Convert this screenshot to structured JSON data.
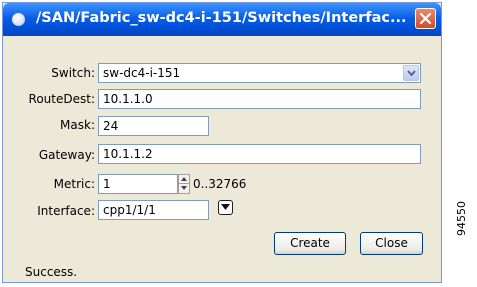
{
  "window": {
    "title": "/SAN/Fabric_sw-dc4-i-151/Switches/Interfac..."
  },
  "form": {
    "switch": {
      "label": "Switch:",
      "value": "sw-dc4-i-151"
    },
    "route_dest": {
      "label": "RouteDest:",
      "value": "10.1.1.0"
    },
    "mask": {
      "label": "Mask:",
      "value": "24"
    },
    "gateway": {
      "label": "Gateway:",
      "value": "10.1.1.2"
    },
    "metric": {
      "label": "Metric:",
      "value": "1",
      "range": "0..32766"
    },
    "interface": {
      "label": "Interface:",
      "value": "cpp1/1/1"
    }
  },
  "buttons": {
    "create": "Create",
    "close": "Close"
  },
  "status": {
    "text": "Success."
  },
  "figure_id": "94550",
  "colors": {
    "titlebar": "#0a5ee6",
    "close_button": "#d44b26",
    "window_bg": "#ece9d8"
  }
}
